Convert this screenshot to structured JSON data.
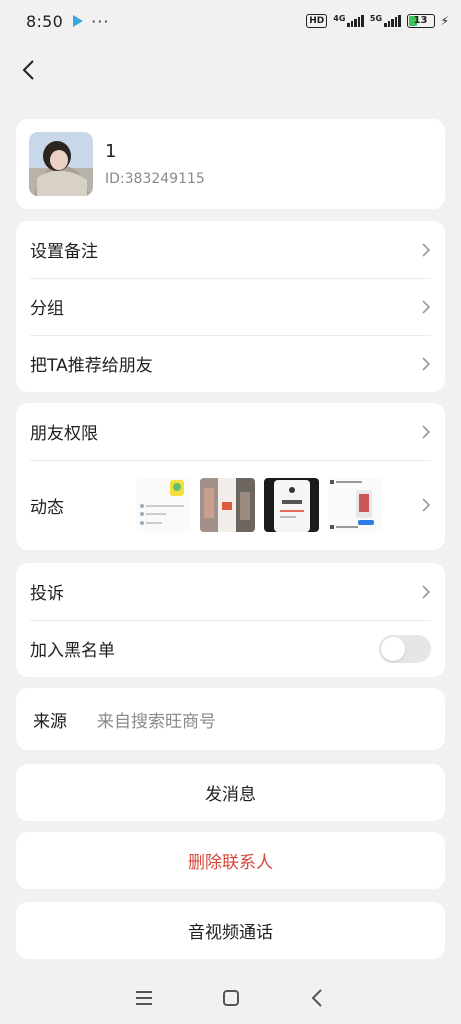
{
  "status_bar": {
    "time": "8:50",
    "dots": "···",
    "hd": "HD",
    "net1": "4G",
    "net2": "5G",
    "battery": "13"
  },
  "profile": {
    "nickname": "1",
    "id_text": "ID:383249115"
  },
  "menu_group_1": [
    {
      "label": "设置备注"
    },
    {
      "label": "分组"
    },
    {
      "label": "把TA推荐给朋友"
    }
  ],
  "menu_group_2": {
    "permissions_label": "朋友权限",
    "moments_label": "动态"
  },
  "menu_group_3": {
    "complaint_label": "投诉",
    "blacklist_label": "加入黑名单",
    "blacklist_enabled": false
  },
  "source": {
    "label": "来源",
    "value": "来自搜索旺商号"
  },
  "buttons": {
    "send_message": "发消息",
    "delete_contact": "删除联系人",
    "av_call": "音视频通话"
  },
  "colors": {
    "danger": "#d9473b",
    "background": "#f1f1f1"
  }
}
